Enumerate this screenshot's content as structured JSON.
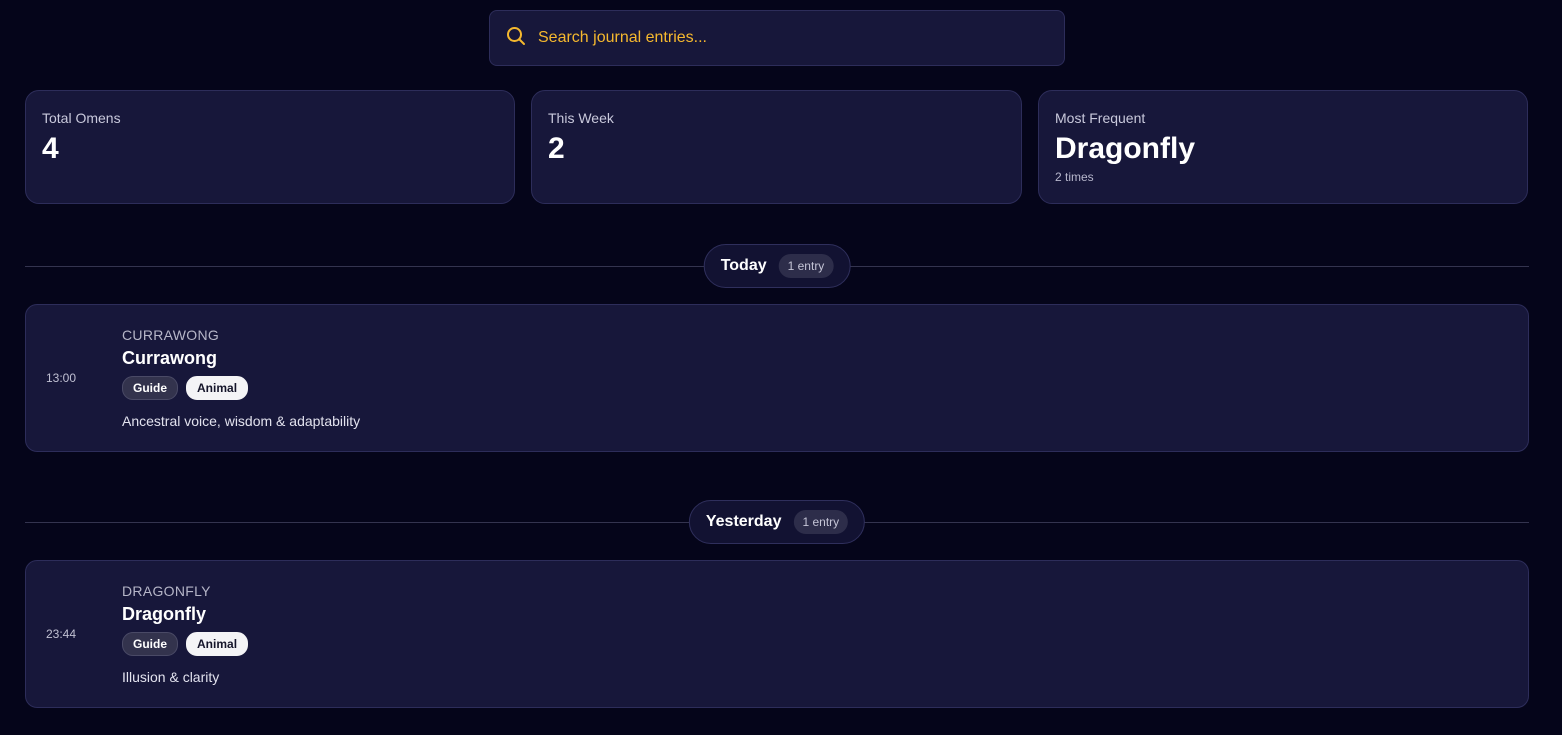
{
  "search": {
    "placeholder": "Search journal entries..."
  },
  "stats": [
    {
      "label": "Total Omens",
      "value": "4",
      "sub": ""
    },
    {
      "label": "This Week",
      "value": "2",
      "sub": ""
    },
    {
      "label": "Most Frequent",
      "value": "Dragonfly",
      "sub": "2 times"
    }
  ],
  "groups": [
    {
      "label": "Today",
      "count": "1 entry",
      "entries": [
        {
          "time": "13:00",
          "kicker": "CURRAWONG",
          "title": "Currawong",
          "tags": [
            "Guide",
            "Animal"
          ],
          "description": "Ancestral voice, wisdom & adaptability"
        }
      ]
    },
    {
      "label": "Yesterday",
      "count": "1 entry",
      "entries": [
        {
          "time": "23:44",
          "kicker": "DRAGONFLY",
          "title": "Dragonfly",
          "tags": [
            "Guide",
            "Animal"
          ],
          "description": "Illusion & clarity"
        }
      ]
    }
  ],
  "colors": {
    "background": "#05051a",
    "card": "#17173a",
    "accent": "#f5b82e"
  },
  "icons": {
    "search": "search-icon"
  }
}
